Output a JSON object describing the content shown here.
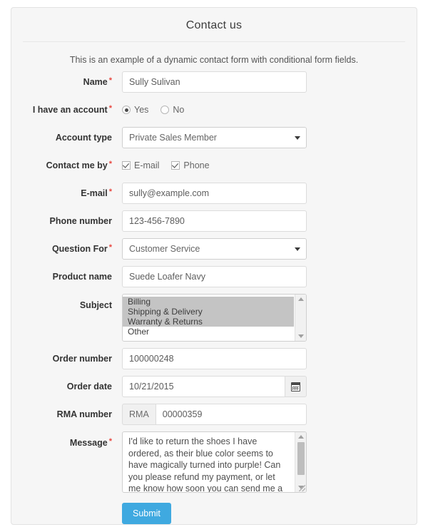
{
  "panel": {
    "title": "Contact us",
    "intro": "This is an example of a dynamic contact form with conditional form fields."
  },
  "fields": {
    "name": {
      "label": "Name",
      "required": "*",
      "value": "Sully Sulivan"
    },
    "have_account": {
      "label": "I have an account",
      "required": "*",
      "options": [
        {
          "label": "Yes",
          "selected": true
        },
        {
          "label": "No",
          "selected": false
        }
      ]
    },
    "account_type": {
      "label": "Account type",
      "value": "Private Sales Member"
    },
    "contact_me_by": {
      "label": "Contact me by",
      "required": "*",
      "options": [
        {
          "label": "E-mail",
          "checked": true
        },
        {
          "label": "Phone",
          "checked": true
        }
      ]
    },
    "email": {
      "label": "E-mail",
      "required": "*",
      "value": "sully@example.com"
    },
    "phone": {
      "label": "Phone number",
      "value": "123-456-7890"
    },
    "question_for": {
      "label": "Question For",
      "required": "*",
      "value": "Customer Service"
    },
    "product_name": {
      "label": "Product name",
      "value": "Suede Loafer Navy"
    },
    "subject": {
      "label": "Subject",
      "options": [
        {
          "label": "Billing",
          "selected": true
        },
        {
          "label": "Shipping & Delivery",
          "selected": true
        },
        {
          "label": "Warranty & Returns",
          "selected": true
        },
        {
          "label": "Other",
          "selected": false
        }
      ]
    },
    "order_number": {
      "label": "Order number",
      "value": "100000248"
    },
    "order_date": {
      "label": "Order date",
      "value": "10/21/2015"
    },
    "rma_number": {
      "label": "RMA number",
      "prefix": "RMA",
      "value": "00000359"
    },
    "message": {
      "label": "Message",
      "required": "*",
      "value": "I'd like to return the shoes I have ordered, as their blue color seems to have magically turned into purple! Can you please refund my payment, or let me know how soon you can send me a replacement pair? Thanks! Sully"
    }
  },
  "actions": {
    "submit_label": "Submit"
  },
  "colors": {
    "accent": "#3fa9e0",
    "required": "#e8473f",
    "panel_bg": "#f6f6f6",
    "selected_option_bg": "#c4c4c4"
  }
}
